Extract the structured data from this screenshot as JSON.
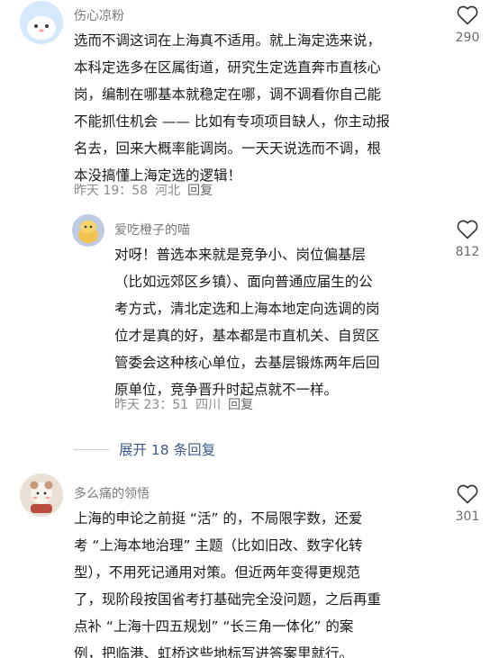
{
  "comments": [
    {
      "username": "伤心凉粉",
      "text": "选而不调这词在上海真不适用。就上海定选来说，\n本科定选多在区属街道，研究生定选直奔市直核心\n岗，编制在哪基本就稳定在哪，调不调看你自己能\n不能抓住机会 —— 比如有专项项目缺人，你主动报\n名去，回来大概率能调岗。一天天说选而不调，根\n本没搞懂上海定选的逻辑！",
      "time": "昨天 19：58",
      "location": "河北",
      "reply_label": "回复",
      "likes": "290"
    },
    {
      "username": "爱吃橙子的喵",
      "text": "对呀！普选本来就是竞争小、岗位偏基层\n（比如远郊区乡镇）、面向普通应届生的公\n考方式，清北定选和上海本地定向选调的岗\n位才是真的好，基本都是市直机关、自贸区\n管委会这种核心单位，去基层锻炼两年后回\n原单位，竞争晋升时起点就不一样。",
      "time": "昨天 23：51",
      "location": "四川",
      "reply_label": "回复",
      "likes": "812"
    },
    {
      "username": "多么痛的领悟",
      "text": "上海的申论之前挺 “活” 的，不局限字数，还爱\n考 “上海本地治理” 主题（比如旧改、数字化转\n型），不用死记通用对策。但近两年变得更规范\n了，现阶段按国省考打基础完全没问题，之后再重\n点补 “上海十四五规划” “长三角一体化” 的案\n例，把临港、虹桥这些地标写进答案里就行。",
      "likes": "301"
    }
  ],
  "expand_replies": "展开 18 条回复",
  "icons": {
    "like": "heart-outline-icon"
  },
  "colors": {
    "link": "#3d5a8c",
    "meta": "#8a8a8a"
  }
}
